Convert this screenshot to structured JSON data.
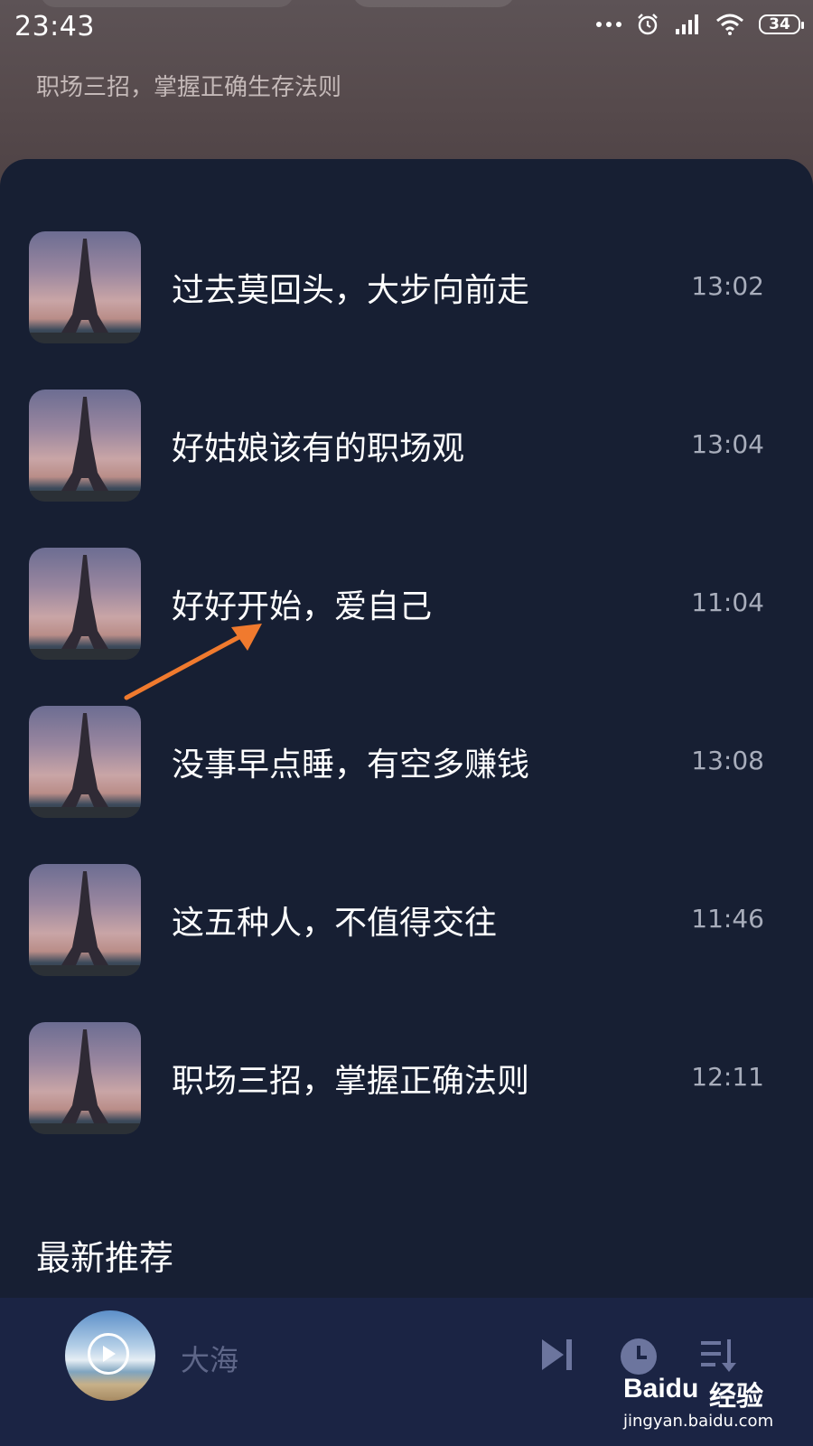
{
  "status_bar": {
    "time": "23:43",
    "battery": "34"
  },
  "header": {
    "subtitle": "职场三招，掌握正确生存法则"
  },
  "playlist": [
    {
      "title": "过去莫回头，大步向前走",
      "duration": "13:02"
    },
    {
      "title": "好姑娘该有的职场观",
      "duration": "13:04"
    },
    {
      "title": "好好开始，爱自己",
      "duration": "11:04"
    },
    {
      "title": "没事早点睡，有空多赚钱",
      "duration": "13:08"
    },
    {
      "title": "这五种人，不值得交往",
      "duration": "11:46"
    },
    {
      "title": "职场三招，掌握正确法则",
      "duration": "12:11"
    }
  ],
  "section": {
    "title": "最新推荐"
  },
  "player": {
    "now_playing": "大海"
  },
  "watermark": {
    "brand": "Baidu",
    "suffix": "经验",
    "url": "jingyan.baidu.com"
  },
  "colors": {
    "panel": "#171f33",
    "player_bar": "#1b2444",
    "annotation_arrow": "#f07a2e"
  }
}
